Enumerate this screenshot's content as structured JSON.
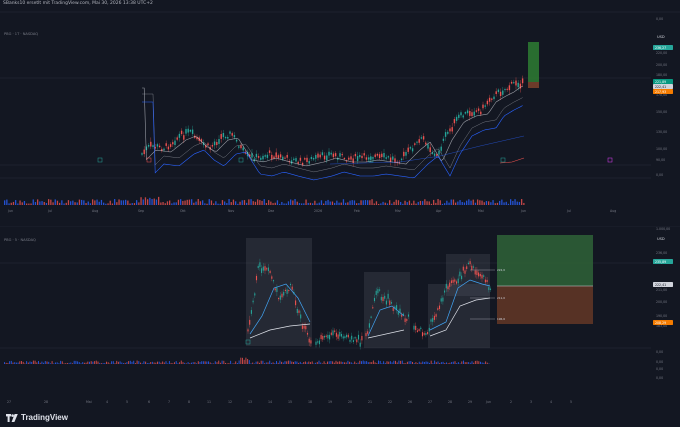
{
  "header": {
    "text": "SBanks10 ersetlt mit TradingView.com, Mai 30, 2026 13:38 UTC+2"
  },
  "pane1": {
    "legend": "PBG · 1T · NASDAQ",
    "currency": "USD",
    "price_ticks": [
      "0,00",
      "220,00",
      "200,00",
      "180,00",
      "170,00",
      "150,00",
      "130,00",
      "100,00",
      "90,00",
      "0,00"
    ],
    "badge_green": "236,27",
    "badge_teal": "221,89",
    "badge_white": "222,41",
    "badge_orange": "217,93",
    "time_ticks": [
      "Jun",
      "Jul",
      "Aug",
      "Sep",
      "Okt",
      "Nov",
      "Dez",
      "2026",
      "Feb",
      "Mrz",
      "Apr",
      "Mai",
      "Jun",
      "Jul",
      "Aug"
    ]
  },
  "pane2": {
    "legend": "PBG · 5 · NASDAQ",
    "currency": "USD",
    "price_ticks": [
      "1.000,00",
      "236,00",
      "222,00",
      "211,00",
      "200,00",
      "190,00",
      "183,00",
      "0,00",
      "0,00",
      "0,00",
      "0,00"
    ],
    "badge_green": "235,89",
    "badge_white": "222,41",
    "badge_orange": "208,29",
    "level_labels": [
      "222,0",
      "211,0",
      "196,6"
    ],
    "time_ticks": [
      "27",
      "28",
      "Mai",
      "4",
      "5",
      "6",
      "7",
      "8",
      "11",
      "12",
      "13",
      "14",
      "15",
      "18",
      "19",
      "20",
      "21",
      "22",
      "26",
      "27",
      "28",
      "29",
      "Jun",
      "2",
      "3",
      "4",
      "5"
    ]
  },
  "footer": {
    "brand": "TradingView"
  },
  "colors": {
    "bg": "#131722",
    "up": "#26a69a",
    "down": "#ef5350",
    "accent": "#2962ff",
    "long_green": "#2e5e36",
    "short_red": "#5b3426"
  }
}
